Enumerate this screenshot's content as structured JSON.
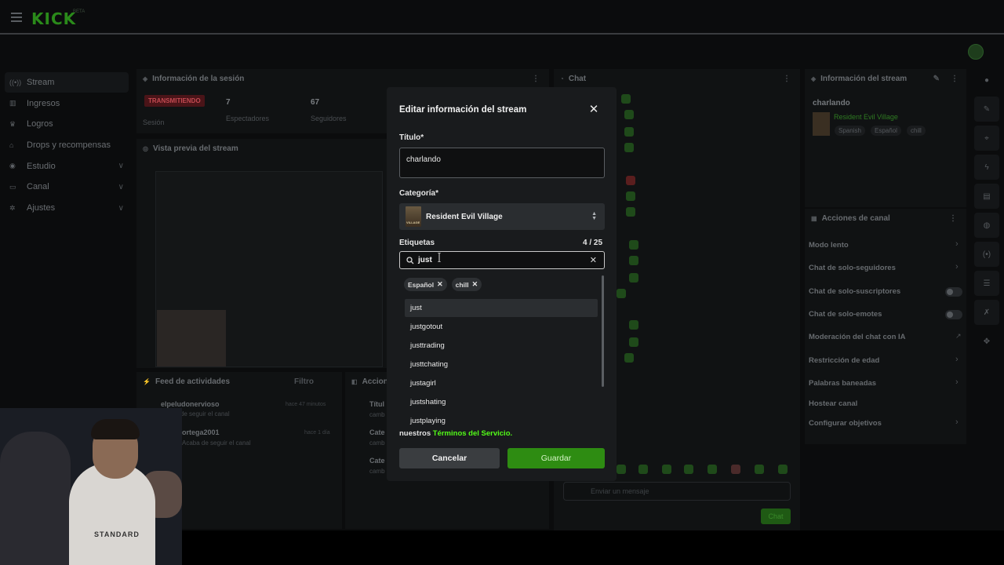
{
  "app": {
    "logo": "KICK",
    "logo_badge": "BETA"
  },
  "sidebar": {
    "items": [
      {
        "label": "Stream",
        "icon": "broadcast-icon",
        "active": true
      },
      {
        "label": "Ingresos",
        "icon": "chart-icon"
      },
      {
        "label": "Logros",
        "icon": "trophy-icon"
      },
      {
        "label": "Drops y recompensas",
        "icon": "gift-icon"
      },
      {
        "label": "Estudio",
        "icon": "studio-icon",
        "expandable": true
      },
      {
        "label": "Canal",
        "icon": "channel-icon",
        "expandable": true
      },
      {
        "label": "Ajustes",
        "icon": "gear-icon",
        "expandable": true
      }
    ]
  },
  "session": {
    "header": "Información de la sesión",
    "live_badge": "TRANSMITIENDO",
    "session_label": "Sesión",
    "viewers": "7",
    "viewers_label": "Espectadores",
    "followers": "67",
    "followers_label": "Seguidores"
  },
  "preview": {
    "header": "Vista previa del stream"
  },
  "feed": {
    "header": "Feed de actividades",
    "filter": "Filtro",
    "rows": [
      {
        "name": "elpeludonervioso",
        "sub": "Acaba de seguir el canal",
        "time": "hace 47 minutos"
      },
      {
        "name": "ortega2001",
        "sub": "Acaba de seguir el canal",
        "time": "hace 1 día"
      }
    ]
  },
  "actions_log": {
    "header": "Accion",
    "items": [
      "Títul",
      "Cate",
      "Cate"
    ],
    "sub": "camb"
  },
  "chat": {
    "header": "Chat",
    "input_placeholder": "Enviar un mensaje",
    "send_label": "Chat"
  },
  "stream_info": {
    "header": "Información del stream",
    "title": "charlando",
    "category": "Resident Evil Village",
    "tags": [
      "Spanish",
      "Español",
      "chill"
    ]
  },
  "channel_actions": {
    "header": "Acciones de canal",
    "items": [
      {
        "label": "Modo lento",
        "control": "chevron"
      },
      {
        "label": "Chat de solo-seguidores",
        "control": "chevron"
      },
      {
        "label": "Chat de solo-suscriptores",
        "control": "toggle"
      },
      {
        "label": "Chat de solo-emotes",
        "control": "toggle"
      },
      {
        "label": "Moderación del chat con IA",
        "control": "external"
      },
      {
        "label": "Restricción de edad",
        "control": "chevron"
      },
      {
        "label": "Palabras baneadas",
        "control": "chevron"
      },
      {
        "label": "Hostear canal",
        "control": "none"
      },
      {
        "label": "Configurar objetivos",
        "control": "chevron"
      }
    ]
  },
  "webcam": {
    "shirt_text": "STANDARD"
  },
  "modal": {
    "title": "Editar información del stream",
    "title_label": "Título*",
    "title_value": "charlando",
    "category_label": "Categoría*",
    "category_value": "Resident Evil Village",
    "category_thumb_text": "VILLAGE",
    "tags_label": "Etiquetas",
    "tags_count": "4 / 25",
    "tag_search_value": "just",
    "selected_tags": [
      "Español",
      "chill"
    ],
    "options": [
      "just",
      "justgotout",
      "justtrading",
      "justtchating",
      "justagirl",
      "justshating",
      "justplaying"
    ],
    "terms_prefix": "nuestros ",
    "terms_link": "Términos del Servicio.",
    "cancel_label": "Cancelar",
    "save_label": "Guardar"
  },
  "colors": {
    "accent": "#53fc18",
    "save": "#2e8c12",
    "live": "#c44a52"
  }
}
